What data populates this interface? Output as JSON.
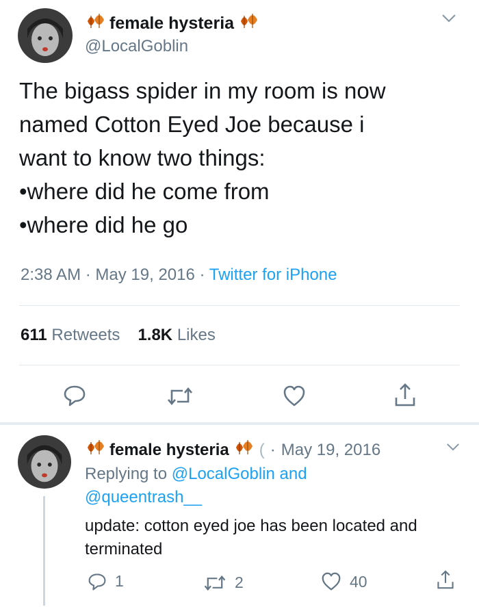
{
  "main_tweet": {
    "display_name": "female hysteria",
    "handle": "@LocalGoblin",
    "text_lines": [
      "The bigass spider in my room is now",
      "named Cotton Eyed Joe because i",
      "want to know two things:",
      "•where did he come from",
      "•where did he go"
    ],
    "time": "2:38 AM",
    "separator": "·",
    "date": "May 19, 2016",
    "source": "Twitter for iPhone",
    "retweets_count": "611",
    "retweets_label": "Retweets",
    "likes_count": "1.8K",
    "likes_label": "Likes"
  },
  "reply_tweet": {
    "display_name": "female hysteria",
    "truncated_handle": "(",
    "separator": "·",
    "date": "May 19, 2016",
    "replying_prefix": "Replying to",
    "replying_handle_1": "@LocalGoblin",
    "replying_and": "and",
    "replying_handle_2": "@queentrash__",
    "text": "update: cotton eyed joe has been located and terminated",
    "reply_count": "1",
    "retweet_count": "2",
    "like_count": "40"
  },
  "icons": {
    "emoji": "fallen-leaves-emoji",
    "more": "chevron-down-icon",
    "reply": "reply-bubble-icon",
    "retweet": "retweet-icon",
    "like": "heart-icon",
    "share": "share-icon"
  },
  "colors": {
    "link": "#1da1f2",
    "secondary_text": "#657786",
    "primary_text": "#14171a",
    "divider": "#e1e8ed"
  }
}
